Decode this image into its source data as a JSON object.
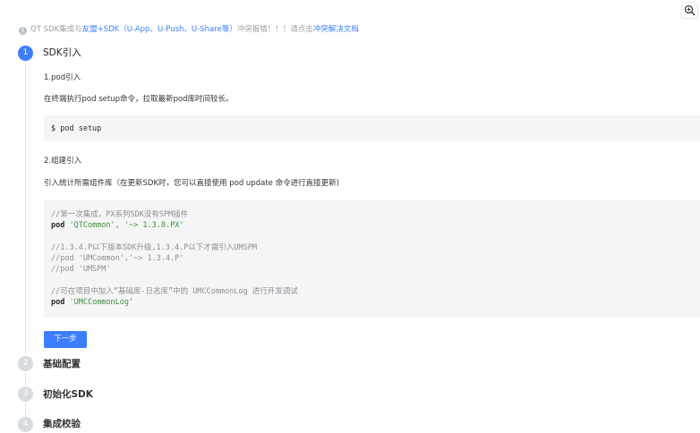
{
  "notice": {
    "prefix": "QT SDK集成与",
    "link1": "友盟+SDK（U-App、U-Push、U-Share等）",
    "middle": "冲突报错！！！请点击",
    "link2": "冲突解决文档"
  },
  "steps": [
    {
      "number": "1",
      "title": "SDK引入",
      "state": "active"
    },
    {
      "number": "2",
      "title": "基础配置",
      "state": "inactive"
    },
    {
      "number": "3",
      "title": "初始化SDK",
      "state": "inactive"
    },
    {
      "number": "4",
      "title": "集成校验",
      "state": "inactive"
    }
  ],
  "step1": {
    "sub1_title": "1.pod引入",
    "sub1_desc": "在终端执行pod setup命令，拉取最新pod库时间较长。",
    "code1": "$ pod setup",
    "sub2_title": "2.组建引入",
    "sub2_desc": "引入统计所需组件库（在更新SDK时，您可以直接使用 pod update 命令进行直接更新)",
    "code2": {
      "c1": "//第一次集成，PX系列SDK没有SPM插件",
      "l2_kw": "pod",
      "l2_str": "'QTCommon'",
      "l2_rest": ", '~> 1.3.8.PX'",
      "c3": "//1.3.4.P以下版本SDK升级,1.3.4.P以下才需引入UMSPM",
      "c4": "//pod 'UMCommon','~> 1.3.4.P'",
      "c5": "//pod 'UMSPM'",
      "c6": "//可在项目中加入“基础库-日志库”中的 UMCCommonLog 进行开发调试",
      "l7_kw": "pod",
      "l7_str": "'UMCCommonLog'"
    },
    "next_button": "下一步"
  },
  "colors": {
    "accent": "#3d7eff",
    "inactive_step": "#d7dbe0",
    "code_bg": "#f5f5f5"
  },
  "icons": {
    "zoom": "zoom-in-icon",
    "info": "info-icon"
  }
}
